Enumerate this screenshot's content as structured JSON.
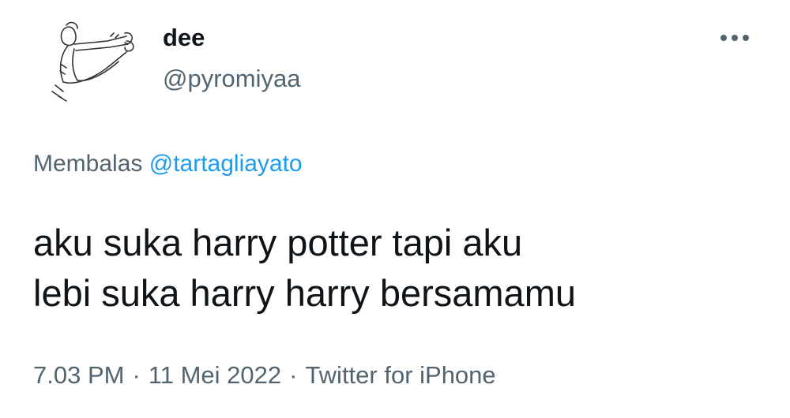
{
  "author": {
    "display_name": "dee",
    "handle": "@pyromiyaa",
    "avatar_icon": "sketch-avatar-icon"
  },
  "more_icon": "more-dots-icon",
  "reply_context": {
    "prefix": "Membalas",
    "mention": "@tartagliayato"
  },
  "tweet": {
    "lines": [
      "aku suka harry potter tapi aku",
      "lebi suka harry harry bersamamu"
    ]
  },
  "meta": {
    "time": "7.03 PM",
    "separator": "·",
    "date": "11 Mei 2022",
    "source": "Twitter for iPhone"
  },
  "colors": {
    "text": "#0f1419",
    "secondary": "#536471",
    "accent": "#1d9bf0"
  }
}
